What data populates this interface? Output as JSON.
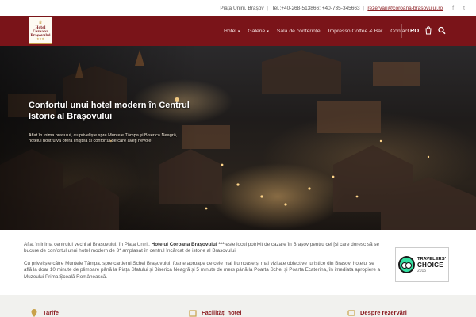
{
  "topbar": {
    "address": "Piața Unirii, Brașov",
    "phone": "Tel.:+40-268-513866; +40-735-345663",
    "email": "rezervari@coroana-brasovului.ro",
    "social_icons": [
      "facebook-icon",
      "twitter-icon"
    ]
  },
  "logo": {
    "line1": "Hotel",
    "line2": "Coroana",
    "line3": "Brașovului",
    "stars": "★★★"
  },
  "nav": {
    "items": [
      {
        "label": "Hotel",
        "has_dropdown": true
      },
      {
        "label": "Galerie",
        "has_dropdown": true
      },
      {
        "label": "Sală de conferințe",
        "has_dropdown": false
      },
      {
        "label": "Impresso Coffee & Bar",
        "has_dropdown": false
      },
      {
        "label": "Contact",
        "has_dropdown": false
      }
    ],
    "language": "RO",
    "icons": [
      "cart-icon",
      "search-icon"
    ]
  },
  "hero": {
    "title": "Confortul unui hotel modern în Centrul Istoric al Brașovului",
    "subtitle": "Aflat în inima orașului, cu priveliște spre Muntele Tâmpa și Biserica Neagră, hotelul nostru vă oferă liniștea și confortul de care aveți nevoie"
  },
  "intro": {
    "p1_before": "Aflat în inima centrului vechi al Brașovului, în Piața Unirii, ",
    "p1_strong": "Hotelul Coroana Brașovului ***",
    "p1_after": " este locul potrivit de cazare în Brașov pentru cei [și care doresc să se bucure de confortul unui hotel modern de 3* amplasat în centrul încărcat de istorie al Brașovului.",
    "p2": "Cu priveliște către Muntele Tâmpa, spre cartierul Schei Brașovului, foarte aproape de cele mai frumoase și mai vizitate obiective turistice din Brașov, hotelul se află la doar 10 minute de plimbare până la Piața Sfatului și Biserica Neagră și 5 minute de mers până la Poarta Schei și Poarta Ecaterina, în imediata apropiere a Muzeului Prima Școală Românească."
  },
  "badge": {
    "line1": "TRAVELERS'",
    "line2": "CHOICE",
    "line3": "2015",
    "brand": "tripadvisor"
  },
  "features": [
    {
      "icon": "location-pin-icon",
      "label": "Tarife"
    },
    {
      "icon": "facilities-icon",
      "label": "Facilități hotel"
    },
    {
      "icon": "contact-icon",
      "label": "Despre rezervări"
    }
  ],
  "colors": {
    "brand": "#7a1419",
    "accent": "#c9a24b"
  }
}
